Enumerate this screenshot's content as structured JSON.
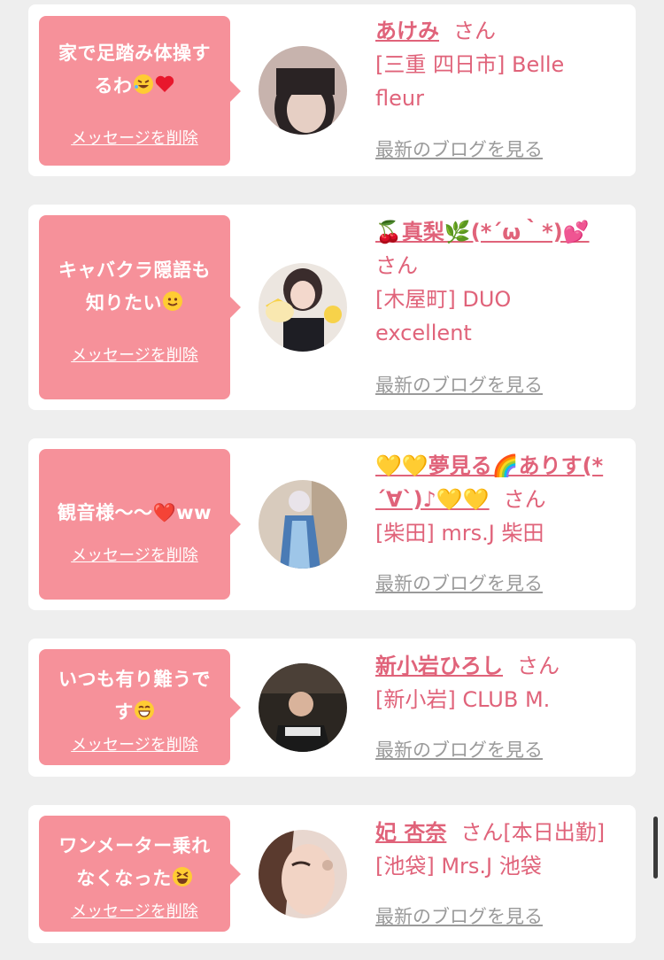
{
  "messages": [
    {
      "text_lines": [
        "家で足踏み体操す",
        "るわ"
      ],
      "text_emojis": [
        "rolling-laughing-emoji",
        "red-heart-emoji"
      ],
      "delete_label": "メッセージを削除",
      "name": "あけみ",
      "honorific": "さん",
      "location_lines": [
        "[三重 四日市] Belle",
        "fleur"
      ],
      "blog_label": "最新のブログを見る"
    },
    {
      "text_lines": [
        "キャバクラ隠語も",
        "知りたい"
      ],
      "text_emojis": [
        "slightly-smiling-emoji"
      ],
      "delete_label": "メッセージを削除",
      "name": "🍒真梨🌿(*´ω｀*)💕",
      "honorific": "さん",
      "location_lines": [
        "[木屋町] DUO",
        "excellent"
      ],
      "blog_label": "最新のブログを見る"
    },
    {
      "text_lines": [
        "観音様〜〜❤️ww"
      ],
      "text_emojis": [
        "red-heart-emoji"
      ],
      "delete_label": "メッセージを削除",
      "name_lines": [
        "💛💛夢見る🌈ありす(*",
        "´∀`)♪💛💛"
      ],
      "honorific": "さん",
      "location_lines": [
        "[柴田] mrs.J 柴田"
      ],
      "blog_label": "最新のブログを見る"
    },
    {
      "text_lines": [
        "いつも有り難うで",
        "す"
      ],
      "text_emojis": [
        "grinning-smiling-eyes-emoji"
      ],
      "delete_label": "メッセージを削除",
      "name": "新小岩ひろし",
      "honorific": "さん",
      "location_lines": [
        "[新小岩] CLUB M."
      ],
      "blog_label": "最新のブログを見る"
    },
    {
      "text_lines": [
        "ワンメーター乗れ",
        "なくなった"
      ],
      "text_emojis": [
        "laughing-squint-emoji"
      ],
      "delete_label": "メッセージを削除",
      "name": "妃 杏奈",
      "honorific": "さん[本日出勤]",
      "location_lines": [
        "[池袋] Mrs.J 池袋"
      ],
      "blog_label": "最新のブログを見る"
    }
  ],
  "colors": {
    "bubble": "#f6919a",
    "name": "#e0637a",
    "link_gray": "#9a9a9a",
    "page_bg": "#eeeeee",
    "card_bg": "#ffffff"
  }
}
